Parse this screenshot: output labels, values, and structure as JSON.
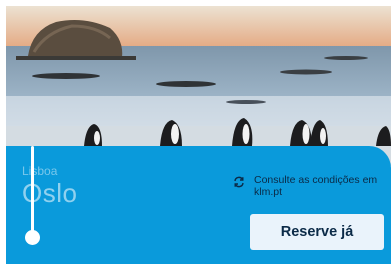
{
  "route": {
    "origin": "Lisboa",
    "destination": "Oslo"
  },
  "conditions": {
    "text": "Consulte as condições em klm.pt",
    "icon": "sync-icon"
  },
  "cta": {
    "label": "Reserve já"
  },
  "colors": {
    "panel": "#0a9adb",
    "button_bg": "#eaf3fb",
    "button_text": "#0b2a47"
  }
}
